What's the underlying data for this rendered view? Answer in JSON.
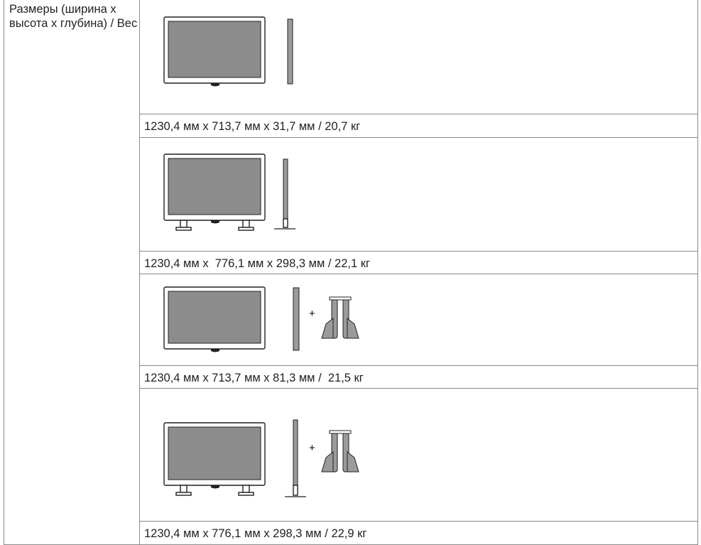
{
  "spec": {
    "label": "Размеры (ширина х высота х глубина) / Вес",
    "rows": [
      {
        "value": "1230,4 мм x 713,7 мм x 31,7 мм / 20,7 кг"
      },
      {
        "value": "1230,4 мм x  776,1 мм x 298,3 мм / 22,1 кг"
      },
      {
        "value": "1230,4 мм x 713,7 мм x 81,3 мм /  21,5 кг"
      },
      {
        "value": "1230,4 мм x 776,1 мм x 298,3 мм / 22,9 кг"
      }
    ],
    "plus_sign": "+"
  }
}
